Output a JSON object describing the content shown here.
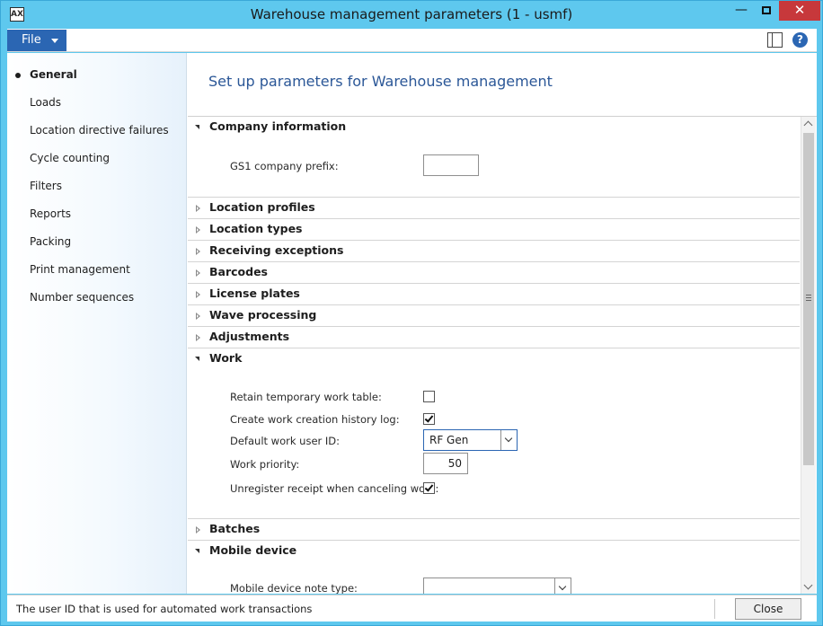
{
  "window": {
    "title": "Warehouse management parameters (1 - usmf)",
    "icon_glyph": "AX",
    "minimize_glyph": "—",
    "close_glyph": "✕"
  },
  "ribbon": {
    "file_label": "File",
    "help_glyph": "?"
  },
  "nav": {
    "items": [
      {
        "label": "General",
        "active": true
      },
      {
        "label": "Loads"
      },
      {
        "label": "Location directive failures"
      },
      {
        "label": "Cycle counting"
      },
      {
        "label": "Filters"
      },
      {
        "label": "Reports"
      },
      {
        "label": "Packing"
      },
      {
        "label": "Print management"
      },
      {
        "label": "Number sequences"
      }
    ]
  },
  "main": {
    "title": "Set up parameters for Warehouse management"
  },
  "sections": {
    "company_information": "Company information",
    "location_profiles": "Location profiles",
    "location_types": "Location types",
    "receiving_exceptions": "Receiving exceptions",
    "barcodes": "Barcodes",
    "license_plates": "License plates",
    "wave_processing": "Wave processing",
    "adjustments": "Adjustments",
    "work": "Work",
    "batches": "Batches",
    "mobile_device": "Mobile device"
  },
  "fields": {
    "gs1_prefix_label": "GS1 company prefix:",
    "gs1_prefix_value": "",
    "retain_temp_label": "Retain temporary work table:",
    "retain_temp_checked": false,
    "create_history_label": "Create work creation history log:",
    "create_history_checked": true,
    "default_user_label": "Default work user ID:",
    "default_user_value": "RF Gen",
    "work_priority_label": "Work priority:",
    "work_priority_value": "50",
    "unregister_label": "Unregister receipt when canceling work:",
    "unregister_checked": true,
    "mobile_note_label": "Mobile device note type:",
    "mobile_note_value": ""
  },
  "status": {
    "text": "The user ID that is used for automated work transactions",
    "close_label": "Close"
  }
}
